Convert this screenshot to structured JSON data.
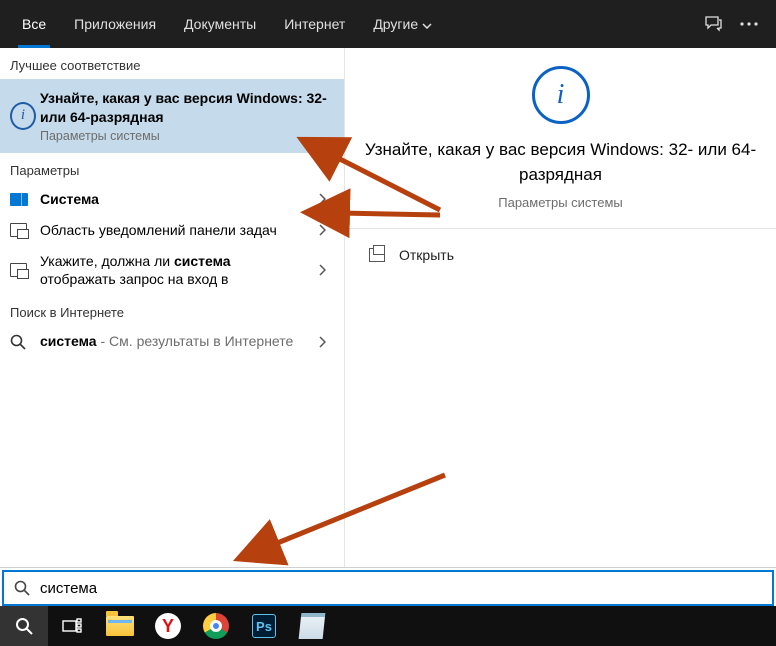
{
  "tabs": {
    "all": "Все",
    "apps": "Приложения",
    "docs": "Документы",
    "web": "Интернет",
    "more": "Другие"
  },
  "sections": {
    "best_match": "Лучшее соответствие",
    "settings": "Параметры",
    "web_search": "Поиск в Интернете"
  },
  "best_match": {
    "title": "Узнайте, какая у вас версия Windows: 32- или 64-разрядная",
    "subtitle": "Параметры системы"
  },
  "settings_results": [
    {
      "title_pre": "",
      "title_bold": "Система",
      "title_post": ""
    },
    {
      "title_pre": "Область уведомлений панели задач",
      "title_bold": "",
      "title_post": ""
    },
    {
      "title_pre": "Укажите, должна ли ",
      "title_bold": "система",
      "title_post": " отображать запрос на вход в"
    }
  ],
  "web_result": {
    "bold": "система",
    "rest": " - См. результаты в Интернете"
  },
  "detail": {
    "title": "Узнайте, какая у вас версия Windows: 32- или 64-разрядная",
    "subtitle": "Параметры системы",
    "open": "Открыть"
  },
  "search": {
    "value": "система"
  }
}
